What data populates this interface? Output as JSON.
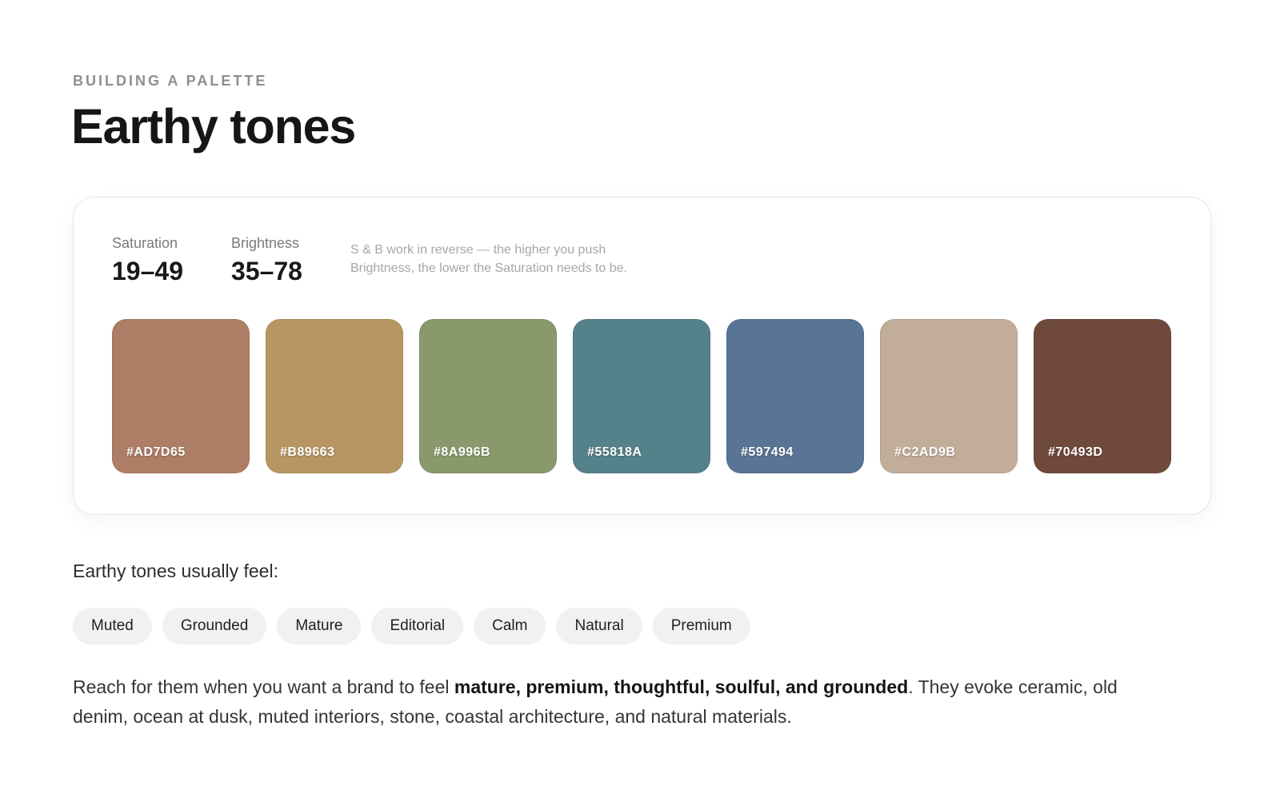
{
  "header": {
    "eyebrow": "BUILDING A PALETTE",
    "title": "Earthy tones"
  },
  "stats": {
    "saturation": {
      "label": "Saturation",
      "value": "19–49"
    },
    "brightness": {
      "label": "Brightness",
      "value": "35–78"
    },
    "note_line1": "S & B work in reverse — the higher you push",
    "note_line2": "Brightness, the lower the Saturation needs to be."
  },
  "swatches": [
    {
      "hex": "#AD7D65",
      "color": "#AD7D65"
    },
    {
      "hex": "#B89663",
      "color": "#B89663"
    },
    {
      "hex": "#8A996B",
      "color": "#8A996B"
    },
    {
      "hex": "#55818A",
      "color": "#55818A"
    },
    {
      "hex": "#597494",
      "color": "#597494"
    },
    {
      "hex": "#C2AD9B",
      "color": "#C2AD9B"
    },
    {
      "hex": "#70493D",
      "color": "#70493D"
    }
  ],
  "feel": {
    "heading": "Earthy tones usually feel:",
    "tags": [
      "Muted",
      "Grounded",
      "Mature",
      "Editorial",
      "Calm",
      "Natural",
      "Premium"
    ]
  },
  "description": {
    "before": "Reach for them when you want a brand to feel ",
    "bold": "mature, premium, thoughtful, soulful, and grounded",
    "after": ". They evoke ceramic, old denim, ocean at dusk, muted interiors, stone, coastal architecture, and natural materials."
  }
}
